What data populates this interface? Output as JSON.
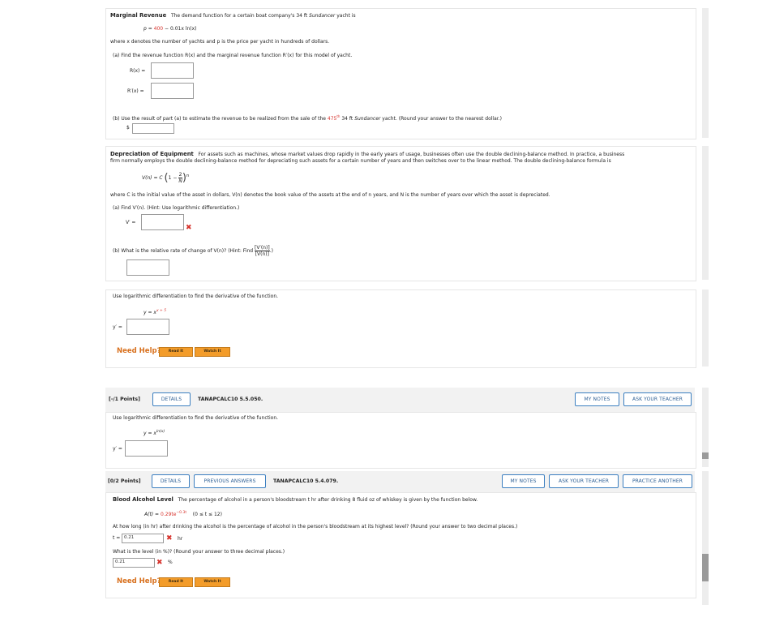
{
  "q_marginal_revenue": {
    "title": "Marginal Revenue",
    "intro": "The demand function for a certain boat company's 34 ft",
    "yacht_name": "Sundancer",
    "intro_end": "yacht is",
    "eq_p": "p =",
    "eq_400": "400",
    "eq_rest": "− 0.01x ln(x)",
    "where_text": "where x denotes the number of yachts and p is the price per yacht in hundreds of dollars.",
    "part_a": "(a)   Find the revenue function R(x) and the marginal revenue function R′(x) for this model of yacht.",
    "label_rx": "R(x)  =",
    "label_rpx": "R′(x)  =",
    "part_b_start": "(b)   Use the result of part (a) to estimate the revenue to be realized from the sale of the",
    "part_b_num": "475",
    "part_b_sup": "th",
    "part_b_mid": "34 ft",
    "part_b_yacht": "Sundancer",
    "part_b_end": "yacht. (Round your answer to the nearest dollar.)",
    "dollar": "$"
  },
  "q_depreciation": {
    "title": "Depreciation of Equipment",
    "intro_line1": "For assets such as machines, whose market values drop rapidly in the early years of usage, businesses often use the double declining-balance method. In practice, a business",
    "intro_line2": "firm normally employs the double declining-balance method for depreciating such assets for a certain number of years and then switches over to the linear method. The double declining-balance formula is",
    "formula_lhs": "V(n)  =  C",
    "formula_body": "1 −",
    "frac_num": "2",
    "frac_den": "N",
    "formula_exp": "n",
    "where_text": "where C is the initial value of the asset in dollars, V(n) denotes the book value of the assets at the end of n years, and N is the number of years over which the asset is depreciated.",
    "part_a": "(a)   Find V′(n). (Hint: Use logarithmic differentiation.)",
    "label_vp": "V′  =",
    "part_b_start": "(b)   What is the relative rate of change of V(n)? (Hint: Find",
    "part_b_num": "[V′(n)]",
    "part_b_den": "[V(n)]",
    "part_b_end": ".)"
  },
  "q_log_diff_1": {
    "instruction": "Use logarithmic differentiation to find the derivative of the function.",
    "eq_lhs": "y  =  x",
    "eq_exp": "x + 5",
    "label_yp": "y′  =",
    "need_help": "Need Help?",
    "read_it": "Read It",
    "watch_it": "Watch It"
  },
  "q_log_diff_2": {
    "points": "[-/1 Points]",
    "details": "DETAILS",
    "code": "TANAPCALC10 5.5.050.",
    "my_notes": "MY NOTES",
    "ask_teacher": "ASK YOUR TEACHER",
    "instruction": "Use logarithmic differentiation to find the derivative of the function.",
    "eq_lhs": "y  =  x",
    "eq_exp": "ln(x)",
    "label_yp": "y′  ="
  },
  "q_blood_alcohol": {
    "points": "[0/2 Points]",
    "details": "DETAILS",
    "previous_answers": "PREVIOUS ANSWERS",
    "code": "TANAPCALC10 5.4.079.",
    "my_notes": "MY NOTES",
    "ask_teacher": "ASK YOUR TEACHER",
    "practice_another": "PRACTICE ANOTHER",
    "title": "Blood Alcohol Level",
    "intro": "The percentage of alcohol in a person's bloodstream t hr after drinking 8 fluid oz of whiskey is given by the function below.",
    "eq_lhs": "A(t)  =",
    "eq_val": "0.29te",
    "eq_exp": "−0.3t",
    "eq_domain": "(0 ≤ t ≤ 12)",
    "q1": "At how long (in hr) after drinking the alcohol is the percentage of alcohol in the person's bloodstream at its highest level? (Round your answer to two decimal places.)",
    "t_label": "t =",
    "t_value": "0.21",
    "t_unit": "hr",
    "q2": "What is the level (in %)? (Round your answer to three decimal places.)",
    "level_value": "0.21",
    "level_unit": "%",
    "need_help": "Need Help?",
    "read_it": "Read It",
    "watch_it": "Watch It"
  }
}
